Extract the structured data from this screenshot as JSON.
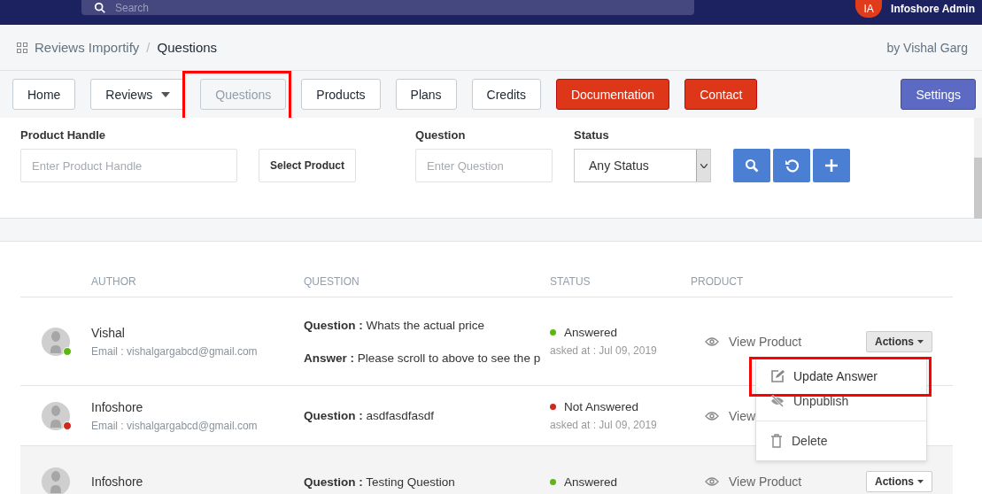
{
  "top_bar": {
    "search_placeholder": "Search",
    "user_initials": "IA",
    "user_name": "Infoshore Admin"
  },
  "breadcrumb": {
    "items": [
      "Reviews Importify",
      "Questions"
    ],
    "separator": "/",
    "byline": "by Vishal Garg"
  },
  "nav": [
    {
      "label": "Home",
      "kind": "plain",
      "selected": false
    },
    {
      "label": "Reviews",
      "kind": "dropdown",
      "selected": false
    },
    {
      "label": "Questions",
      "kind": "plain",
      "selected": true
    },
    {
      "label": "Products",
      "kind": "plain",
      "selected": false
    },
    {
      "label": "Plans",
      "kind": "plain",
      "selected": false
    },
    {
      "label": "Credits",
      "kind": "plain",
      "selected": false
    },
    {
      "label": "Documentation",
      "kind": "danger",
      "selected": false
    },
    {
      "label": "Contact",
      "kind": "danger",
      "selected": false
    },
    {
      "label": "Settings",
      "kind": "primary",
      "selected": false
    }
  ],
  "filters": {
    "product_handle": {
      "label": "Product Handle",
      "placeholder": "Enter Product Handle"
    },
    "select_product": "Select Product",
    "question": {
      "label": "Question",
      "placeholder": "Enter Question"
    },
    "status": {
      "label": "Status",
      "value": "Any Status"
    }
  },
  "table": {
    "columns": [
      "AUTHOR",
      "QUESTION",
      "STATUS",
      "PRODUCT"
    ],
    "rows": [
      {
        "author": "Vishal",
        "email": "Email : vishalgargabcd@gmail.com",
        "color": "#5cb811",
        "question": "**Question :** Whats the actual price",
        "answer": "**Answer :** Please scroll to above to see the p",
        "status": "Answered",
        "answered": true,
        "asked_at": "asked at : Jul 09, 2019",
        "product": "View Product",
        "actions": "Actions",
        "actions_open": true,
        "hovered": false
      },
      {
        "author": "Infoshore",
        "email": "Email : vishalgargabcd@gmail.com",
        "color": "#d0281e",
        "question": "**Question :** asdfasdfasdf",
        "status": "Not Answered",
        "answered": false,
        "asked_at": "asked at : Jul 09, 2019",
        "product": "View",
        "hovered": false
      },
      {
        "author": "Infoshore",
        "question": "**Question :** Testing Question",
        "status": "Answered",
        "answered": true,
        "product": "View Product",
        "actions": "Actions",
        "actions_open": false,
        "hovered": true
      }
    ]
  },
  "actions_menu": [
    {
      "label": "Update Answer",
      "kind": "edit",
      "highlighted": true
    },
    {
      "label": "Unpublish",
      "kind": "hide",
      "highlighted": false
    },
    {
      "label": "Delete",
      "kind": "delete",
      "highlighted": false
    }
  ]
}
